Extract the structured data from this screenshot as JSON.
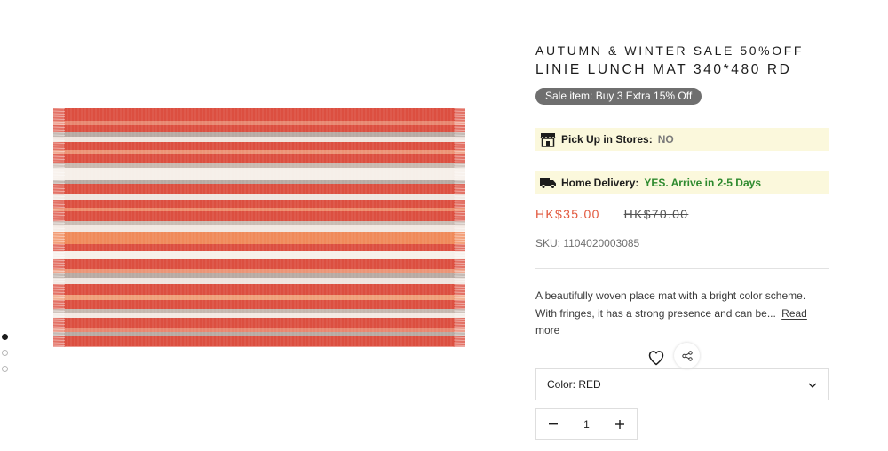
{
  "gallery": {
    "image_alt": "Striped woven lunch mat in red, peach, grey and white",
    "dots": [
      {
        "active": true
      },
      {
        "active": false
      },
      {
        "active": false
      }
    ]
  },
  "product": {
    "sale_title": "AUTUMN & WINTER SALE 50%OFF",
    "title": "LINIE LUNCH MAT 340*480 RD",
    "sale_badge": "Sale item: Buy 3 Extra 15% Off",
    "pickup": {
      "label": "Pick Up in Stores:",
      "value": "NO",
      "icon": "store-icon"
    },
    "delivery": {
      "label": "Home Delivery:",
      "value": "YES. Arrive in 2-5 Days",
      "icon": "truck-icon"
    },
    "price_sale": "HK$35.00",
    "price_original": "HK$70.00",
    "sku": "SKU: 1104020003085",
    "description": "A beautifully woven place mat with a bright color scheme. With fringes, it has a strong presence and can be...",
    "read_more": "Read more",
    "color_select": "Color: RED",
    "quantity": "1"
  },
  "colors": {
    "accent_price": "#e2583d",
    "delivery_green": "#2e8a2e",
    "notice_bg": "#fbf8dc",
    "badge_bg": "#6f6f6f"
  }
}
